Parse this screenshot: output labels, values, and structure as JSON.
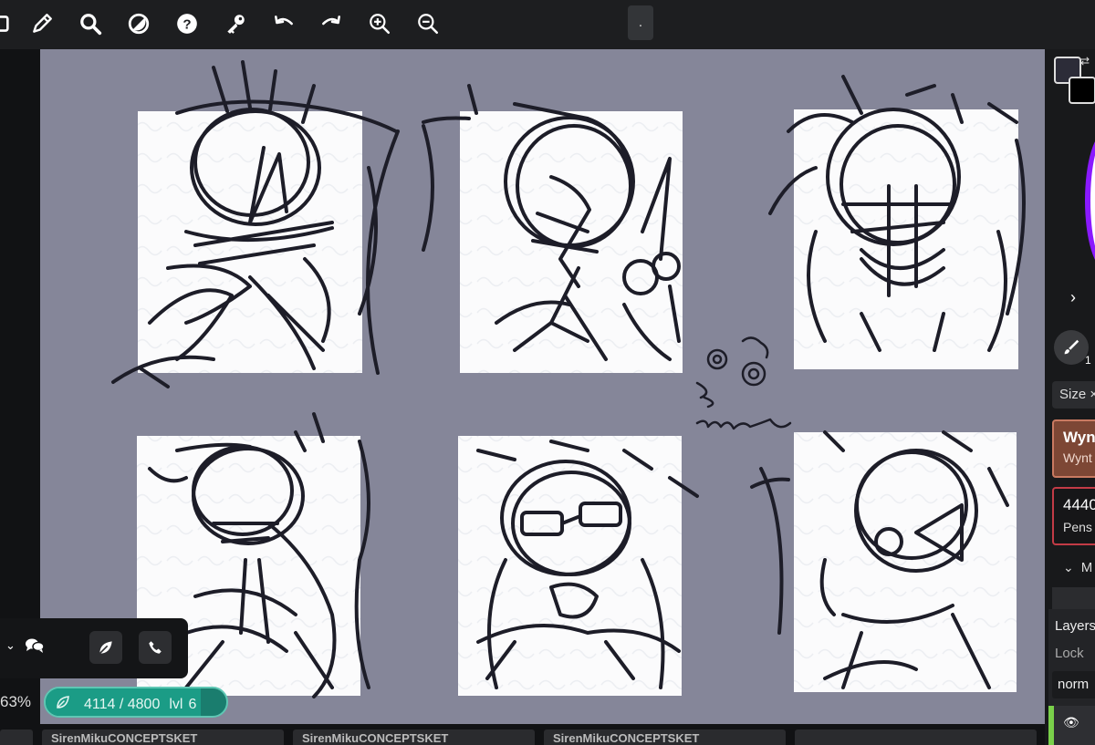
{
  "toolbar": {
    "tools": [
      "brush-icon",
      "search-icon",
      "contrast-icon",
      "help-icon",
      "key-icon",
      "undo-icon",
      "redo-icon",
      "zoom-in-icon",
      "zoom-out-icon"
    ],
    "more_label": "."
  },
  "canvas": {
    "background": "#858699",
    "panel_color": "#ffffff",
    "ink_color": "#1d1d28"
  },
  "right_panel": {
    "primary_color": "#2c2c38",
    "secondary_color": "#000000",
    "brush_number": "1",
    "size_label": "Size ×",
    "brush_cards": [
      {
        "title": "Wyn",
        "subtitle": "Wynt"
      },
      {
        "title": "4440",
        "subtitle": "Pens"
      }
    ],
    "section_label": "M",
    "layers_label": "Layers",
    "lock_label": "Lock",
    "blend_mode": "norm"
  },
  "chat": {
    "chat_icon": "chat-icon",
    "leaf_icon": "leaf-icon",
    "phone_icon": "phone-icon"
  },
  "status": {
    "zoom": "63%",
    "strokes": "4114 / 4800",
    "stroke_progress": 0.857,
    "level_label": "lvl",
    "level": "6"
  },
  "bottom_tabs": [
    {
      "label": ""
    },
    {
      "label": "SirenMikuCONCEPTSKET"
    },
    {
      "label": "SirenMikuCONCEPTSKET"
    },
    {
      "label": "SirenMikuCONCEPTSKET"
    },
    {
      "label": ""
    }
  ]
}
